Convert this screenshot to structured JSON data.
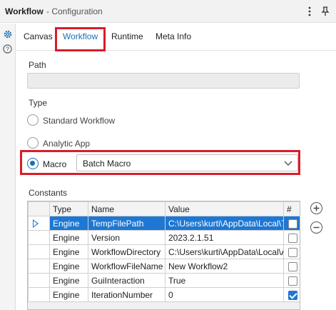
{
  "window": {
    "title": "Workflow",
    "subtitle": "- Configuration",
    "menu_icon": "kebab-menu-icon",
    "pin_icon": "pin-icon"
  },
  "rail": {
    "icons": [
      "gear-icon",
      "help-icon"
    ]
  },
  "tabs": [
    {
      "label": "Canvas",
      "active": false
    },
    {
      "label": "Workflow",
      "active": true
    },
    {
      "label": "Runtime",
      "active": false
    },
    {
      "label": "Meta Info",
      "active": false
    }
  ],
  "path": {
    "label": "Path",
    "value": ""
  },
  "type": {
    "label": "Type",
    "options": [
      {
        "label": "Standard Workflow",
        "checked": false
      },
      {
        "label": "Analytic App",
        "checked": false
      },
      {
        "label": "Macro",
        "checked": true
      }
    ],
    "macro_select": {
      "value": "Batch Macro"
    }
  },
  "constants": {
    "label": "Constants",
    "columns": [
      "Type",
      "Name",
      "Value",
      "#"
    ],
    "rows": [
      {
        "type": "Engine",
        "name": "TempFilePath",
        "value": "C:\\Users\\kurti\\AppData\\Local\\Te",
        "checked": false,
        "selected": true
      },
      {
        "type": "Engine",
        "name": "Version",
        "value": "2023.2.1.51",
        "checked": false,
        "selected": false
      },
      {
        "type": "Engine",
        "name": "WorkflowDirectory",
        "value": "C:\\Users\\kurti\\AppData\\Local\\A",
        "checked": false,
        "selected": false
      },
      {
        "type": "Engine",
        "name": "WorkflowFileName",
        "value": "New Workflow2",
        "checked": false,
        "selected": false
      },
      {
        "type": "Engine",
        "name": "GuiInteraction",
        "value": "True",
        "checked": false,
        "selected": false
      },
      {
        "type": "Engine",
        "name": "IterationNumber",
        "value": "0",
        "checked": true,
        "selected": false
      }
    ],
    "add_icon": "plus-circle-icon",
    "remove_icon": "minus-circle-icon"
  },
  "colors": {
    "accent": "#1a6fb5",
    "highlight": "#d91c2a",
    "selection": "#1e77d2"
  }
}
